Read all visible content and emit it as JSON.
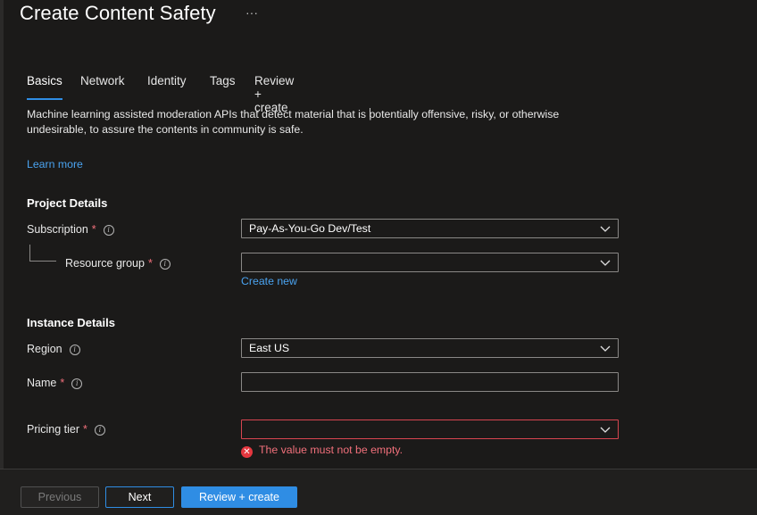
{
  "page": {
    "title": "Create Content Safety",
    "more": "···"
  },
  "tabs": [
    {
      "label": "Basics",
      "active": true
    },
    {
      "label": "Network",
      "active": false
    },
    {
      "label": "Identity",
      "active": false
    },
    {
      "label": "Tags",
      "active": false
    },
    {
      "label": "Review + create",
      "active": false
    }
  ],
  "description": "Machine learning assisted moderation APIs that detect material that is potentially offensive, risky, or otherwise undesirable, to assure the contents in community is safe.",
  "learn_more": "Learn more",
  "project_details": {
    "title": "Project Details",
    "subscription": {
      "label": "Subscription",
      "required": "*",
      "value": "Pay-As-You-Go Dev/Test"
    },
    "resource_group": {
      "label": "Resource group",
      "required": "*",
      "value": "",
      "create_new": "Create new"
    }
  },
  "instance_details": {
    "title": "Instance Details",
    "region": {
      "label": "Region",
      "value": "East US"
    },
    "name": {
      "label": "Name",
      "required": "*",
      "value": ""
    },
    "pricing_tier": {
      "label": "Pricing tier",
      "required": "*",
      "value": "",
      "error": "The value must not be empty."
    }
  },
  "footer": {
    "previous": "Previous",
    "next": "Next",
    "review_create": "Review + create"
  },
  "colors": {
    "background": "#1b1a19",
    "accent": "#2f8de4",
    "link": "#4aa3f0",
    "error": "#f1707b",
    "required": "#f1707b"
  },
  "icons": {
    "info": "info-icon",
    "chevron": "chevron-down-icon",
    "error": "error-icon"
  }
}
